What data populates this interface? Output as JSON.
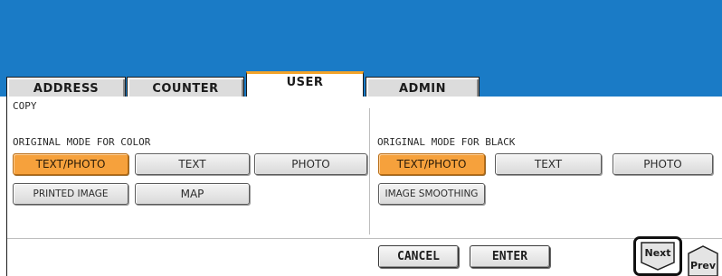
{
  "tabs": [
    {
      "label": "ADDRESS"
    },
    {
      "label": "COUNTER"
    },
    {
      "label": "USER"
    },
    {
      "label": "ADMIN"
    }
  ],
  "section_label": "COPY",
  "color_group": {
    "heading": "ORIGINAL MODE FOR COLOR",
    "buttons": [
      "TEXT/PHOTO",
      "TEXT",
      "PHOTO",
      "PRINTED IMAGE",
      "MAP"
    ],
    "selected": "TEXT/PHOTO"
  },
  "black_group": {
    "heading": "ORIGINAL MODE FOR BLACK",
    "buttons": [
      "TEXT/PHOTO",
      "TEXT",
      "PHOTO",
      "IMAGE SMOOTHING"
    ],
    "selected": "TEXT/PHOTO"
  },
  "actions": {
    "cancel": "CANCEL",
    "enter": "ENTER"
  },
  "nav": {
    "next": "Next",
    "prev": "Prev"
  },
  "colors": {
    "header": "#1a7bc6",
    "selected": "#f6a13c",
    "active_tab_accent": "#f2a32a"
  }
}
